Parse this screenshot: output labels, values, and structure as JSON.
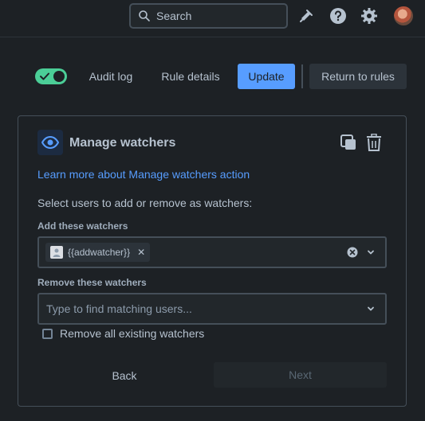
{
  "topbar": {
    "search_label": "Search",
    "icons": [
      "search-icon",
      "notification-icon",
      "help-icon",
      "settings-icon",
      "avatar"
    ]
  },
  "toolbar": {
    "enabled": true,
    "audit_log": "Audit log",
    "rule_details": "Rule details",
    "update": "Update",
    "return_to_rules": "Return to rules"
  },
  "card": {
    "title": "Manage watchers",
    "learn_more": "Learn more about Manage watchers action",
    "instruction": "Select users to add or remove as watchers:",
    "add_label": "Add these watchers",
    "add_chip": "{{addwatcher}}",
    "remove_label": "Remove these watchers",
    "remove_placeholder": "Type to find matching users...",
    "remove_all_label": "Remove all existing watchers",
    "remove_all_checked": false,
    "back": "Back",
    "next": "Next"
  },
  "colors": {
    "background": "#1d2125",
    "accent": "#579dff",
    "toggle_on": "#4bce97",
    "text": "#b6c2cf"
  }
}
